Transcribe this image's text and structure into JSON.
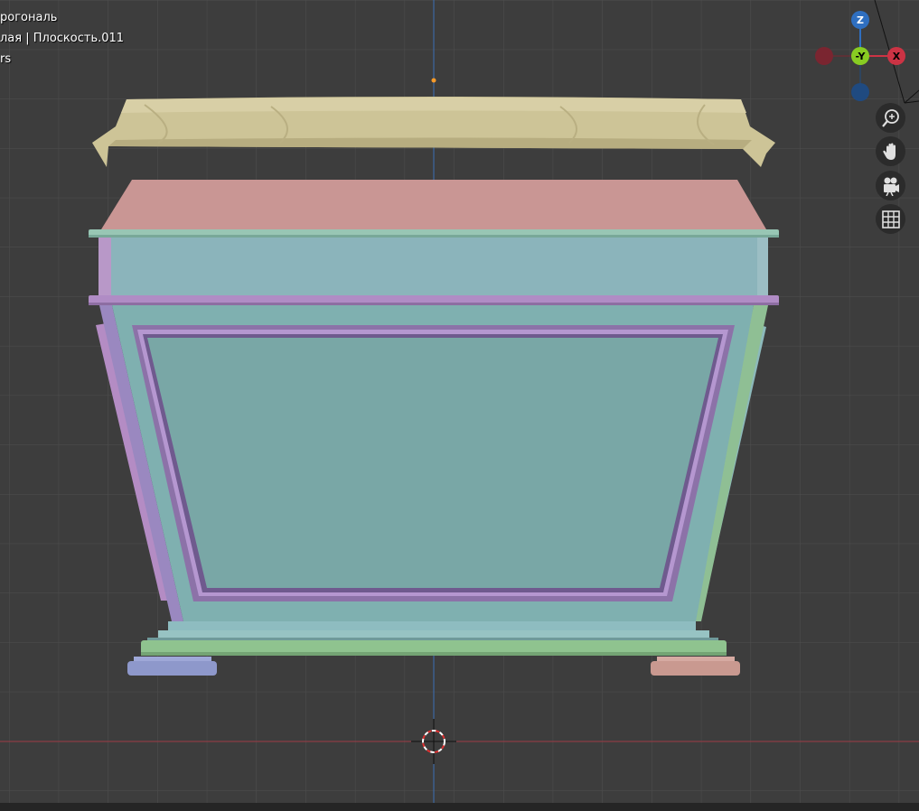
{
  "overlay": {
    "view_name": "рогональ",
    "collection_object": "лая | Плоскость.011",
    "units": "rs"
  },
  "gizmo": {
    "z_label": "Z",
    "neg_y_label": "-Y",
    "x_label": "X",
    "x_color": "#cc3344",
    "y_color": "#88cc22",
    "z_color": "#2f6fc0"
  },
  "nav_buttons": [
    "zoom-icon",
    "pan-hand-icon",
    "camera-icon",
    "grid-icon"
  ],
  "colors": {
    "background": "#3d3d3d",
    "grid": "#4e4e4e",
    "x_axis": "#9e3b45",
    "z_axis": "#3c6fb5",
    "cloth": "#cdc497",
    "top_slab": "#c99694",
    "body_blue": "#8bb4bb",
    "panel_teal": "#7aa8a6",
    "trim_purple": "#b08cc5",
    "trim_green": "#8fbf94"
  }
}
